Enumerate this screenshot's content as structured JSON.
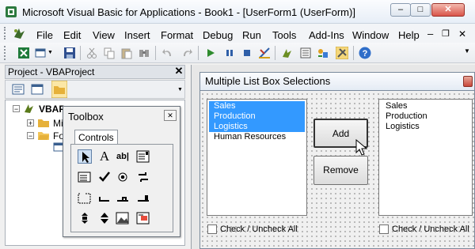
{
  "window": {
    "title": "Microsoft Visual Basic for Applications - Book1 - [UserForm1 (UserForm)]",
    "controls": {
      "minimize": "–",
      "maximize": "□",
      "close": "✕"
    }
  },
  "menu": {
    "items": [
      "File",
      "Edit",
      "View",
      "Insert",
      "Format",
      "Debug",
      "Run",
      "Tools",
      "Add-Ins",
      "Window",
      "Help"
    ],
    "mdi_controls": {
      "minimize": "–",
      "restore": "❐",
      "close": "✕"
    }
  },
  "project": {
    "title": "Project - VBAProject",
    "close": "✕",
    "tree": {
      "root": "VBAP",
      "child1": "Mi",
      "child2": "Fo"
    }
  },
  "toolbox": {
    "title": "Toolbox",
    "close": "✕",
    "tab": "Controls",
    "tools_row1": [
      "pointer",
      "A",
      "ab|",
      "list"
    ],
    "colors": {
      "selected_bg": "#cfe0f3"
    }
  },
  "form": {
    "title": "Multiple List Box Selections",
    "list_left": {
      "items": [
        {
          "label": "Sales",
          "selected": true
        },
        {
          "label": "Production",
          "selected": true
        },
        {
          "label": "Logistics",
          "selected": true
        },
        {
          "label": "Human Resources",
          "selected": false
        }
      ]
    },
    "list_right": {
      "items": [
        {
          "label": "Sales"
        },
        {
          "label": "Production"
        },
        {
          "label": "Logistics"
        }
      ]
    },
    "add_button": "Add",
    "remove_button": "Remove",
    "check_left": "Check / Uncheck All",
    "check_right": "Check / Uncheck All"
  },
  "colors": {
    "selection": "#3399ff",
    "accent": "#4f81bd"
  }
}
